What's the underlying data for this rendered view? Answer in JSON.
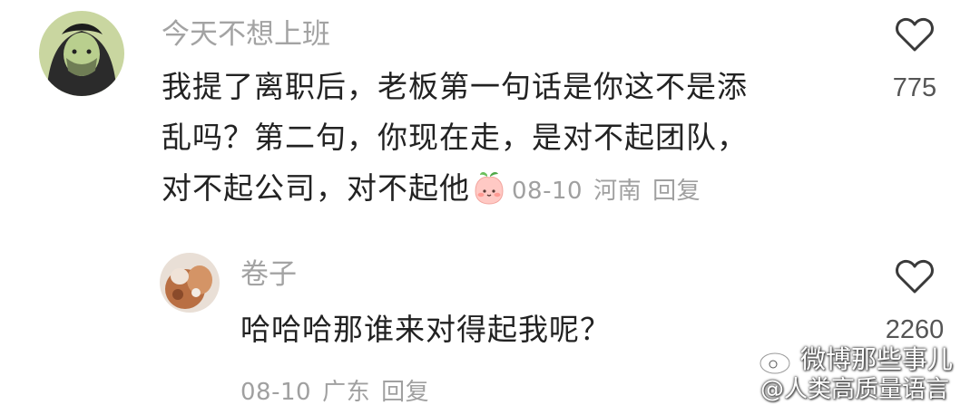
{
  "comment": {
    "username": "今天不想上班",
    "text_lines": [
      "我提了离职后，老板第一句话是你这不是添",
      "乱吗？第二句，你现在走，是对不起团队，",
      "对不起公司，对不起他"
    ],
    "emoji": "peach-blush-emoji",
    "date": "08-10",
    "location": "河南",
    "reply_label": "回复",
    "like_count": "775",
    "like_icon": "heart-outline-icon"
  },
  "reply": {
    "username": "卷子",
    "text": "哈哈哈那谁来对得起我呢？",
    "date": "08-10",
    "location": "广东",
    "reply_label": "回复",
    "like_count": "2260",
    "like_icon": "heart-outline-icon"
  },
  "watermark": {
    "line1": "微博那些事儿",
    "line2": "@人类高质量语言",
    "logo": "weibo-logo-icon"
  },
  "colors": {
    "text": "#222222",
    "muted": "#a0a0a0",
    "background": "#ffffff"
  }
}
